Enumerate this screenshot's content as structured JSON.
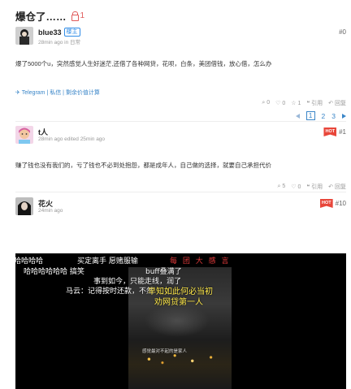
{
  "thread": {
    "title": "爆仓了……",
    "lock_count": "1"
  },
  "posts": [
    {
      "username": "blue33",
      "badge": "楼主",
      "time": "28min ago",
      "in_label": "in",
      "category": "日常",
      "floor": "#0",
      "body": "爆了5000个u，突然感觉人生好迷茫,还借了各种网贷，花呗，白条，美团借钱，放心借，怎么办",
      "links": "Telegram | 私信 | 剩余价值计算",
      "actions": {
        "view": "0",
        "like": "0",
        "star": "1",
        "quote": "引用",
        "reply": "回复"
      }
    },
    {
      "username": "t人",
      "time": "28min ago",
      "edited": "edited 25min ago",
      "floor": "#1",
      "hot": "HOT",
      "body": "赚了钱也没有我们的，亏了钱也不必到处抱怨，都是成年人，自己做的选择，就要自己承担代价",
      "actions": {
        "view": "5",
        "like": "0",
        "quote": "引用",
        "reply": "回复"
      }
    },
    {
      "username": "花火",
      "time": "24min ago",
      "floor": "#10",
      "hot": "HOT"
    }
  ],
  "pagination": {
    "current": "1",
    "p2": "2",
    "p3": "3"
  },
  "video": {
    "danmaku": [
      "哈哈哈哈",
      "买定离手 愿赌服输",
      "哈哈哈哈哈哈 搞笑",
      "buff叠满了",
      "事到如今，只能走线，润了",
      "马云：记得按时还款，不然",
      "每  团  大  感  言"
    ],
    "overlay_line1": "早知如此何必当初",
    "overlay_line2": "劝网贷第一人",
    "subtitle": "感觉最对不起的是家人"
  },
  "colors": {
    "accent": "#3a86c8",
    "hot": "#e8463a",
    "lock": "#e05a5a"
  }
}
